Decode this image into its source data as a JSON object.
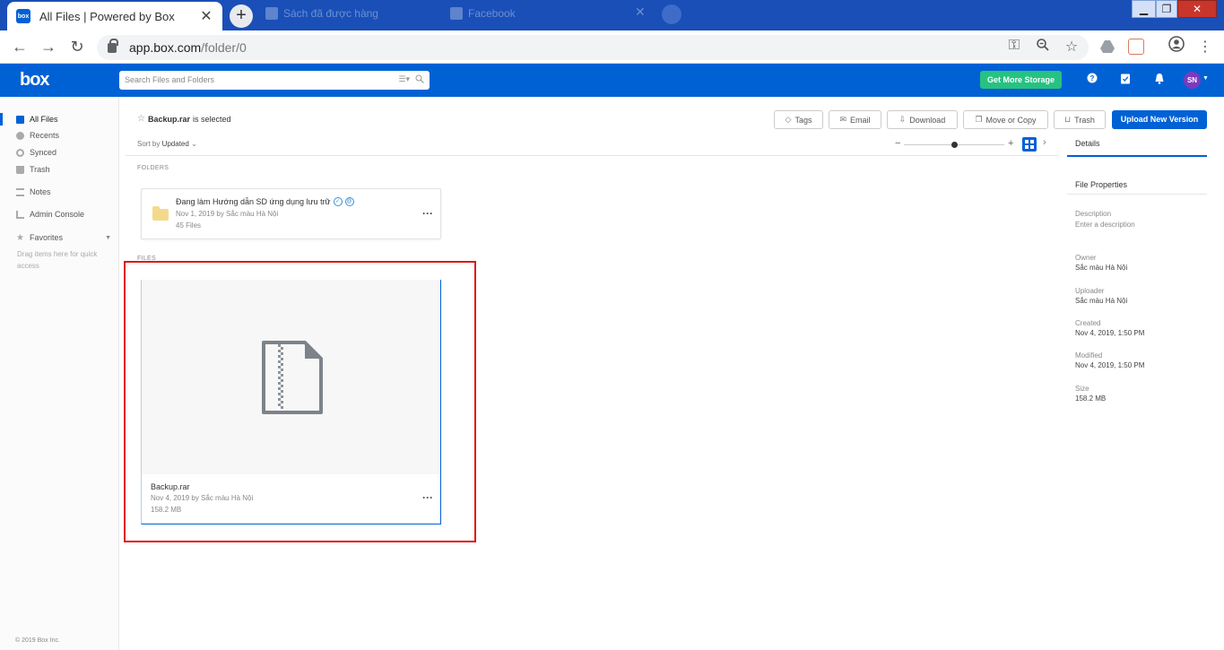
{
  "browser": {
    "tab_title": "All Files | Powered by Box",
    "favicon_text": "box",
    "bg_tab_1": "Sách đã được hàng",
    "bg_tab_2": "Facebook",
    "url_host": "app.box.com",
    "url_path": "/folder/0"
  },
  "header": {
    "logo": "box",
    "search_placeholder": "Search Files and Folders",
    "get_storage": "Get More Storage",
    "avatar_initials": "SN"
  },
  "sidebar": {
    "items": [
      {
        "label": "All Files"
      },
      {
        "label": "Recents"
      },
      {
        "label": "Synced"
      },
      {
        "label": "Trash"
      },
      {
        "label": "Notes"
      },
      {
        "label": "Admin Console"
      },
      {
        "label": "Favorites"
      }
    ],
    "favorites_hint": "Drag items here for quick access",
    "copyright": "© 2019 Box Inc."
  },
  "main": {
    "selected_name": "Backup.rar",
    "selected_suffix": "is selected",
    "actions": {
      "tags": "Tags",
      "email": "Email",
      "download": "Download",
      "move": "Move or Copy",
      "trash": "Trash",
      "upload": "Upload New Version"
    },
    "sort_label": "Sort by",
    "sort_value": "Updated",
    "folders_label": "FOLDERS",
    "files_label": "FILES",
    "folder": {
      "name": "Đang làm  Hướng dẫn SD ứng dụng lưu trữ",
      "meta": "Nov 1, 2019 by Sắc màu Hà Nội",
      "count": "45 Files"
    },
    "file": {
      "name": "Backup.rar",
      "meta": "Nov 4, 2019 by Sắc màu Hà Nội",
      "size": "158.2 MB"
    }
  },
  "details": {
    "tab": "Details",
    "section": "File Properties",
    "description_label": "Description",
    "description_placeholder": "Enter a description",
    "owner_label": "Owner",
    "owner": "Sắc màu Hà Nội",
    "uploader_label": "Uploader",
    "uploader": "Sắc màu Hà Nội",
    "created_label": "Created",
    "created": "Nov 4, 2019, 1:50 PM",
    "modified_label": "Modified",
    "modified": "Nov 4, 2019, 1:50 PM",
    "size_label": "Size",
    "size": "158.2 MB"
  },
  "colors": {
    "brand_blue": "#0061d5",
    "storage_green": "#26c281",
    "highlight_red": "#e01010"
  }
}
